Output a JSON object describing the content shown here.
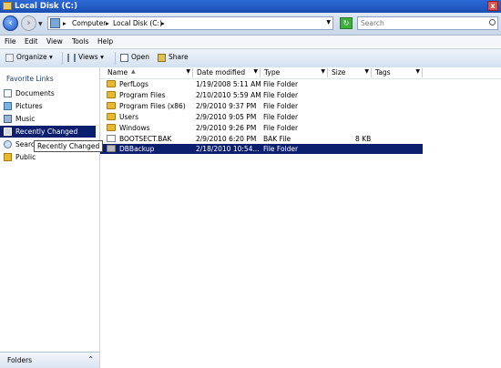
{
  "window": {
    "title": "Local Disk (C:)",
    "close_glyph": "x"
  },
  "address": {
    "crumbs": [
      "Computer",
      "Local Disk (C:)"
    ],
    "separator": "▸",
    "search_placeholder": "Search"
  },
  "menu": [
    "File",
    "Edit",
    "View",
    "Tools",
    "Help"
  ],
  "toolbar": {
    "organize": "Organize",
    "views": "Views",
    "open": "Open",
    "share": "Share"
  },
  "sidebar": {
    "title": "Favorite Links",
    "items": [
      {
        "label": "Documents",
        "icon": "documents-icon"
      },
      {
        "label": "Pictures",
        "icon": "pictures-icon"
      },
      {
        "label": "Music",
        "icon": "music-icon"
      },
      {
        "label": "Recently Changed",
        "icon": "recent-icon",
        "selected": true
      },
      {
        "label": "Searches",
        "icon": "searches-icon"
      },
      {
        "label": "Public",
        "icon": "public-icon"
      }
    ],
    "tooltip": "Recently Changed",
    "folders_label": "Folders"
  },
  "columns": [
    "Name",
    "Date modified",
    "Type",
    "Size",
    "Tags"
  ],
  "files": [
    {
      "name": "PerfLogs",
      "date": "1/19/2008 5:11 AM",
      "type": "File Folder",
      "size": "",
      "icon": "folder-icon"
    },
    {
      "name": "Program Files",
      "date": "2/10/2010 5:59 AM",
      "type": "File Folder",
      "size": "",
      "icon": "folder-icon"
    },
    {
      "name": "Program Files (x86)",
      "date": "2/9/2010 9:37 PM",
      "type": "File Folder",
      "size": "",
      "icon": "folder-icon"
    },
    {
      "name": "Users",
      "date": "2/9/2010 9:05 PM",
      "type": "File Folder",
      "size": "",
      "icon": "folder-icon"
    },
    {
      "name": "Windows",
      "date": "2/9/2010 9:26 PM",
      "type": "File Folder",
      "size": "",
      "icon": "folder-icon"
    },
    {
      "name": "BOOTSECT.BAK",
      "date": "2/9/2010 6:20 PM",
      "type": "BAK File",
      "size": "8 KB",
      "icon": "file-icon"
    },
    {
      "name": "DBBackup",
      "date": "2/18/2010 10:54...",
      "type": "File Folder",
      "size": "",
      "icon": "folder-icon",
      "selected": true
    }
  ],
  "colors": {
    "selection": "#0b1f6e",
    "titlebar": "#2d6ad6",
    "folder": "#e8b830"
  }
}
